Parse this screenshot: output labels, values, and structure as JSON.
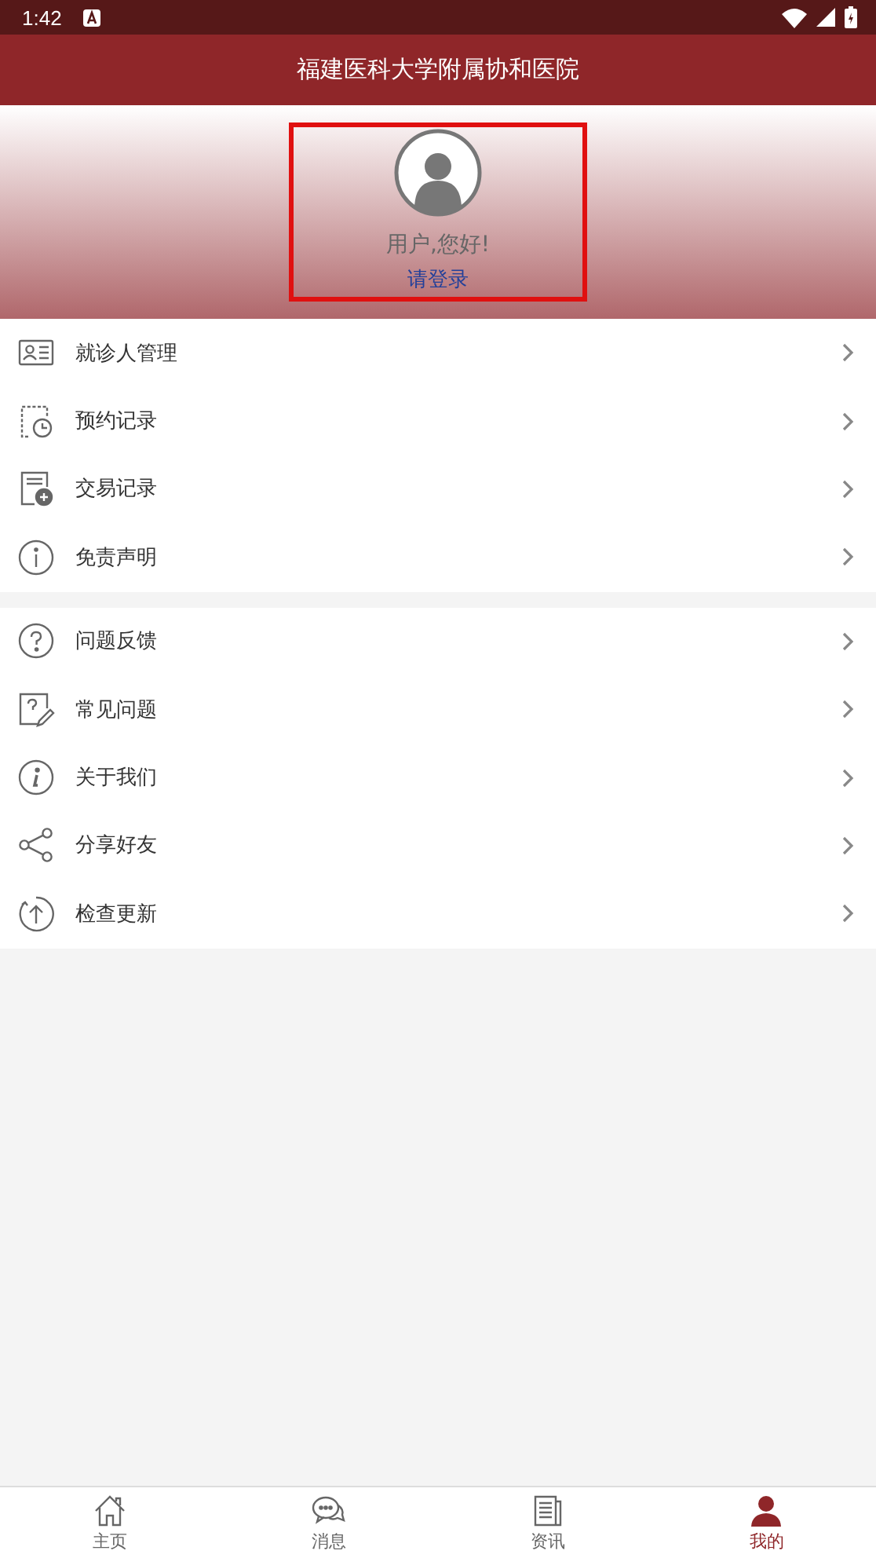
{
  "status_bar": {
    "time": "1:42"
  },
  "header": {
    "title": "福建医科大学附属协和医院"
  },
  "profile": {
    "greeting": "用户,您好!",
    "login_link": "请登录",
    "highlighted": true
  },
  "menu_groups": [
    {
      "items": [
        {
          "label": "就诊人管理",
          "kind": "card"
        },
        {
          "label": "预约记录",
          "kind": "calendar"
        },
        {
          "label": "交易记录",
          "kind": "receipt"
        },
        {
          "label": "免责声明",
          "kind": "info"
        }
      ]
    },
    {
      "items": [
        {
          "label": "问题反馈",
          "kind": "question"
        },
        {
          "label": "常见问题",
          "kind": "faq"
        },
        {
          "label": "关于我们",
          "kind": "about"
        },
        {
          "label": "分享好友",
          "kind": "share"
        },
        {
          "label": "检查更新",
          "kind": "update"
        }
      ]
    }
  ],
  "tab_bar": [
    {
      "label": "主页",
      "kind": "home",
      "selected": false
    },
    {
      "label": "消息",
      "kind": "chat",
      "selected": false
    },
    {
      "label": "资讯",
      "kind": "news",
      "selected": false
    },
    {
      "label": "我的",
      "kind": "person",
      "selected": true
    }
  ]
}
